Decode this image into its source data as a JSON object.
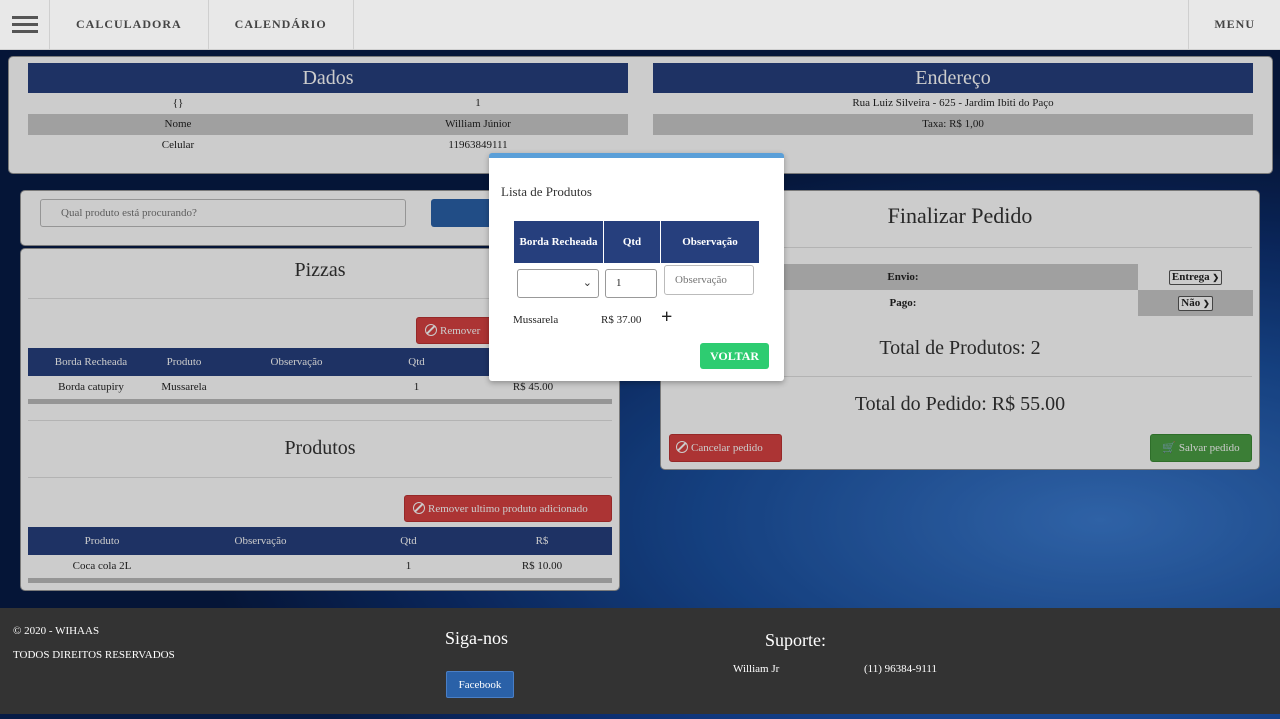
{
  "nav": {
    "calc": "CALCULADORA",
    "cal": "CALENDÁRIO",
    "menu": "MENU"
  },
  "dados": {
    "title": "Dados",
    "rows": [
      [
        "{}",
        "1"
      ],
      [
        "Nome",
        "William Júnior"
      ],
      [
        "Celular",
        "11963849111"
      ]
    ]
  },
  "endereco": {
    "title": "Endereço",
    "rows": [
      "Rua Luiz Silveira - 625 - Jardim Ibiti do Paço",
      "Taxa: R$ 1,00"
    ]
  },
  "search": {
    "placeholder": "Qual produto está procurando?"
  },
  "pizzas": {
    "title": "Pizzas",
    "remove": "Remover",
    "headers": [
      "Borda Recheada",
      "Produto",
      "Observação",
      "Qtd",
      ""
    ],
    "rows": [
      [
        "Borda catupiry",
        "Mussarela",
        "",
        "1",
        "R$ 45.00"
      ]
    ]
  },
  "produtos": {
    "title": "Produtos",
    "remove": "Remover ultimo produto adicionado",
    "headers": [
      "Produto",
      "Observação",
      "Qtd",
      "R$"
    ],
    "rows": [
      [
        "Coca cola 2L",
        "",
        "1",
        "R$ 10.00"
      ]
    ]
  },
  "finalizar": {
    "title": "Finalizar Pedido",
    "envio_label": "Envio:",
    "envio_value": "Entrega",
    "pago_label": "Pago:",
    "pago_value": "Não",
    "total_produtos": "Total de Produtos: 2",
    "total_pedido": "Total do Pedido: R$ 55.00",
    "cancel": "Cancelar pedido",
    "save": "Salvar pedido"
  },
  "modal": {
    "title": "Lista de Produtos",
    "headers": [
      "Borda Recheada",
      "Qtd",
      "Observação"
    ],
    "qtd_value": "1",
    "obs_placeholder": "Observação",
    "product": "Mussarela",
    "price": "R$ 37.00",
    "back": "VOLTAR"
  },
  "footer": {
    "copyright": "© 2020 - WIHAAS",
    "rights": "TODOS DIREITOS RESERVADOS",
    "follow": "Siga-nos",
    "facebook": "Facebook",
    "support": "Suporte:",
    "contact_name": "William Jr",
    "contact_phone": "(11) 96384-9111"
  },
  "colors": {
    "header_blue": "#263f7d",
    "danger": "#d84242",
    "success": "#4a9e44",
    "modal_ok": "#2ecc71"
  }
}
